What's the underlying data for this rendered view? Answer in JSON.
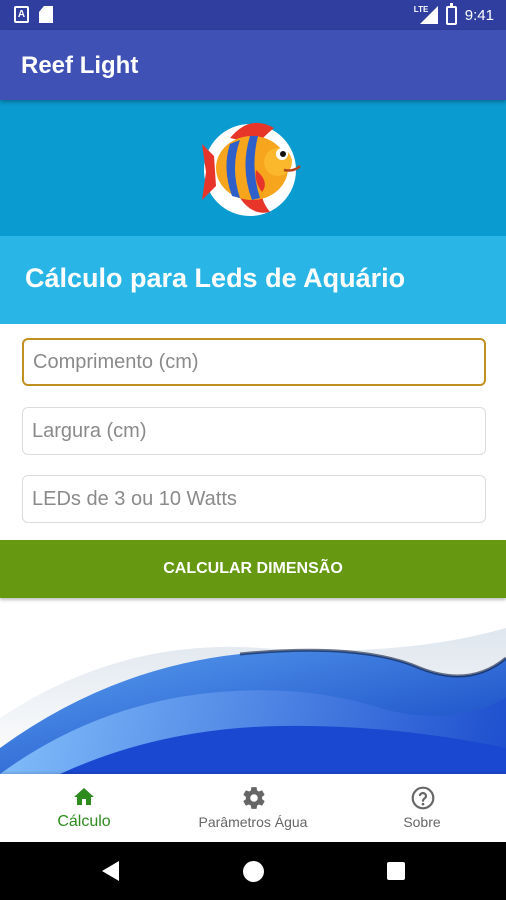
{
  "status_bar": {
    "time": "9:41",
    "network": "LTE",
    "icons": [
      "app-notification-icon",
      "sd-card-icon",
      "signal-icon",
      "battery-icon"
    ]
  },
  "app_bar": {
    "title": "Reef Light"
  },
  "banner": {
    "logo": "fish-logo-icon",
    "background": "#0a9bd0"
  },
  "heading": {
    "text": "Cálculo para Leds de Aquário",
    "background": "#29b6e6"
  },
  "form": {
    "length": {
      "placeholder": "Comprimento (cm)",
      "value": ""
    },
    "width": {
      "placeholder": "Largura (cm)",
      "value": ""
    },
    "leds": {
      "placeholder": "LEDs de 3 ou 10 Watts",
      "value": ""
    }
  },
  "button": {
    "label": "CALCULAR DIMENSÃO",
    "color": "#669911"
  },
  "bottom_nav": {
    "items": [
      {
        "label": "Cálculo",
        "icon": "home-icon",
        "active": true
      },
      {
        "label": "Parâmetros Água",
        "icon": "gear-icon",
        "active": false
      },
      {
        "label": "Sobre",
        "icon": "help-circle-icon",
        "active": false
      }
    ],
    "active_color": "#2e8b1e"
  },
  "colors": {
    "primary": "#3f51b5",
    "primary_dark": "#303f9f",
    "focus_border": "#c09020"
  }
}
